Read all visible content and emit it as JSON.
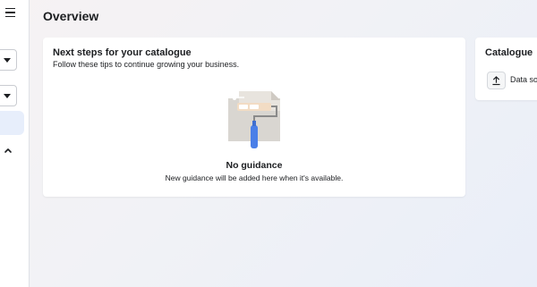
{
  "page": {
    "title": "Overview"
  },
  "guidance_card": {
    "title": "Next steps for your catalogue",
    "subtitle": "Follow these tips to continue growing your business.",
    "empty_title": "No guidance",
    "empty_description": "New guidance will be added here when it's available.",
    "illustration": "paint-roller-illustration"
  },
  "catalogue_card": {
    "title": "Catalogue",
    "item_label": "Data so",
    "item_icon": "upload-icon"
  },
  "sidebar": {
    "menu_icon": "hamburger-icon",
    "dropdown_icon": "caret-down-icon",
    "collapse_icon": "chevron-up-icon",
    "accent": "#e7eefb"
  },
  "colors": {
    "accent": "#4a7fe8",
    "card": "#ffffff"
  }
}
